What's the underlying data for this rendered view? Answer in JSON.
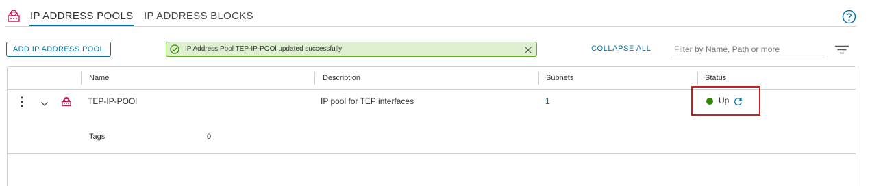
{
  "tabs": [
    {
      "label": "IP ADDRESS POOLS",
      "active": true
    },
    {
      "label": "IP ADDRESS BLOCKS",
      "active": false
    }
  ],
  "toolbar": {
    "add_label": "ADD IP ADDRESS POOL",
    "collapse_label": "COLLAPSE ALL",
    "filter_placeholder": "Filter by Name, Path or more"
  },
  "alert": {
    "message": "IP Address Pool TEP-IP-POOl updated successfully",
    "type": "success"
  },
  "grid": {
    "columns": [
      "Name",
      "Description",
      "Subnets",
      "Status"
    ],
    "rows": [
      {
        "name": "TEP-IP-POOl",
        "description": "IP pool for TEP interfaces",
        "subnets": "1",
        "status": "Up",
        "details": {
          "tags_label": "Tags",
          "tags_value": "0"
        }
      }
    ]
  },
  "icons": {
    "pool": "ip-pool-icon",
    "help": "help-icon",
    "success": "check-circle-icon",
    "close": "close-icon",
    "filter": "filter-icon",
    "actions": "vertical-ellipsis-icon",
    "expand": "chevron-down-icon",
    "refresh": "refresh-icon"
  },
  "colors": {
    "accent": "#0072a3",
    "success_bg": "#dff0d0",
    "success_border": "#5eb715",
    "status_up": "#318700",
    "highlight": "#cc1f1f",
    "pool_icon": "#c21d5a"
  }
}
